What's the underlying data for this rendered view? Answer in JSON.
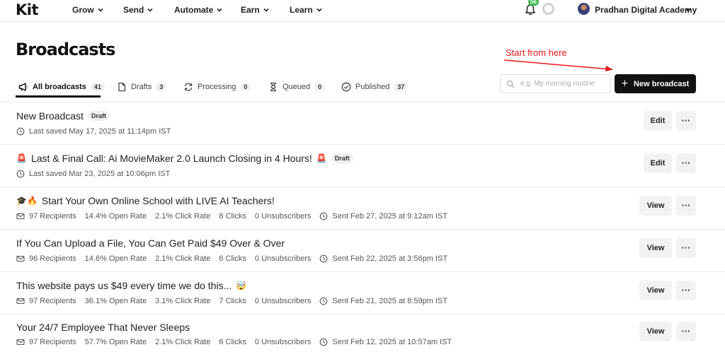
{
  "nav": {
    "logo": "Kit",
    "items": [
      {
        "label": "Grow"
      },
      {
        "label": "Send"
      },
      {
        "label": "Automate"
      },
      {
        "label": "Earn"
      },
      {
        "label": "Learn"
      }
    ],
    "notifications_count": "56",
    "account_name": "Pradhan Digital Academy"
  },
  "page": {
    "title": "Broadcasts",
    "annotation": "Start from here",
    "annotation_color": "#e8181b"
  },
  "tabs": [
    {
      "label": "All broadcasts",
      "count": "41",
      "icon": "megaphone-icon"
    },
    {
      "label": "Drafts",
      "count": "3",
      "icon": "document-icon"
    },
    {
      "label": "Processing",
      "count": "0",
      "icon": "sync-icon"
    },
    {
      "label": "Queued",
      "count": "0",
      "icon": "hourglass-icon"
    },
    {
      "label": "Published",
      "count": "37",
      "icon": "check-circle-icon"
    }
  ],
  "search": {
    "placeholder": "e.g. My morning routine",
    "value": ""
  },
  "toolbar": {
    "new_label": "New broadcast"
  },
  "broadcasts": [
    {
      "title": "New Broadcast",
      "prefix_emoji": "",
      "suffix_emoji": "",
      "badge": "Draft",
      "saved": "Last saved May 17, 2025 at 11:14pm IST",
      "action": "Edit"
    },
    {
      "title": "Last & Final Call: Ai MovieMaker 2.0 Launch Closing in 4 Hours!",
      "prefix_emoji": "🚨",
      "suffix_emoji": "🚨",
      "badge": "Draft",
      "saved": "Last saved Mar 23, 2025 at 10:06pm IST",
      "action": "Edit"
    },
    {
      "title": "Start Your Own Online School with LIVE AI Teachers!",
      "prefix_emoji": "🎓🔥",
      "suffix_emoji": "",
      "recipients": "97 Recipients",
      "open_rate": "14.4% Open Rate",
      "click_rate": "2.1% Click Rate",
      "clicks": "8 Clicks",
      "unsubscribers": "0 Unsubscribers",
      "sent": "Sent Feb 27, 2025 at 9:12am IST",
      "action": "View"
    },
    {
      "title": "If You Can Upload a File, You Can Get Paid $49 Over & Over",
      "prefix_emoji": "",
      "suffix_emoji": "",
      "recipients": "96 Recipients",
      "open_rate": "14.6% Open Rate",
      "click_rate": "2.1% Click Rate",
      "clicks": "6 Clicks",
      "unsubscribers": "0 Unsubscribers",
      "sent": "Sent Feb 22, 2025 at 3:56pm IST",
      "action": "View"
    },
    {
      "title": "This website pays us $49 every time we do this...",
      "prefix_emoji": "",
      "suffix_emoji": "🤯",
      "recipients": "97 Recipients",
      "open_rate": "36.1% Open Rate",
      "click_rate": "3.1% Click Rate",
      "clicks": "7 Clicks",
      "unsubscribers": "0 Unsubscribers",
      "sent": "Sent Feb 21, 2025 at 8:59pm IST",
      "action": "View"
    },
    {
      "title": "Your 24/7 Employee That Never Sleeps",
      "prefix_emoji": "",
      "suffix_emoji": "",
      "recipients": "97 Recipients",
      "open_rate": "57.7% Open Rate",
      "click_rate": "2.1% Click Rate",
      "clicks": "6 Clicks",
      "unsubscribers": "0 Unsubscribers",
      "sent": "Sent Feb 12, 2025 at 10:57am IST",
      "action": "View"
    }
  ]
}
